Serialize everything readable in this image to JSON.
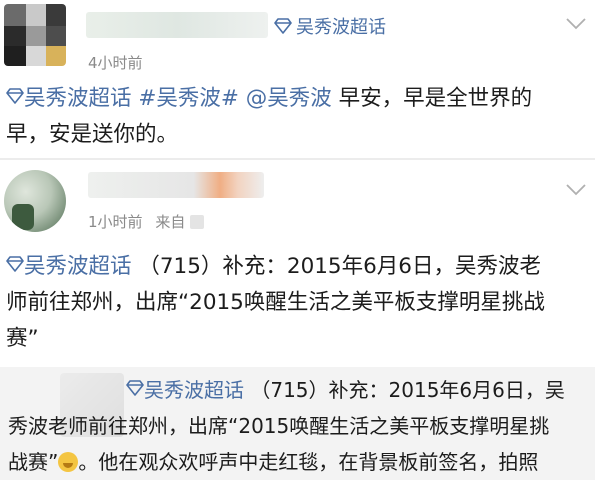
{
  "posts": [
    {
      "supertag": "吴秀波超话",
      "time": "4小时前",
      "lines": [
        {
          "tag": "吴秀波超话",
          "hashtag": "#吴秀波#",
          "mention": "@吴秀波",
          "text": "早安，早是全世界的"
        },
        {
          "text": "早，安是送你的。"
        }
      ]
    },
    {
      "time": "1小时前",
      "source_prefix": "来自",
      "lines": [
        {
          "tag": "吴秀波超话",
          "text": "（715）补充：2015年6月6日，吴秀波老"
        },
        {
          "text": "师前往郑州，出席“2015唤醒生活之美平板支撑明星挑战"
        },
        {
          "text": "赛”"
        }
      ]
    },
    {
      "lines": [
        {
          "tag": "吴秀波超话",
          "text": "（715）补充：2015年6月6日，吴"
        },
        {
          "text": "秀波老师前往郑州，出席“2015唤醒生活之美平板支撑明星挑"
        },
        {
          "text": "战赛”",
          "emoji": "grinning-sweat-emoji",
          "after": "。他在观众欢呼声中走红毯，在背景板前签名，拍照"
        }
      ]
    }
  ],
  "colors": {
    "link": "#4a6fa5",
    "meta": "#8a8a8a",
    "text": "#1c1c1c",
    "quoted_bg": "#f3f3f3"
  },
  "icons": {
    "supertag": "diamond-icon",
    "more": "chevron-down-icon"
  }
}
